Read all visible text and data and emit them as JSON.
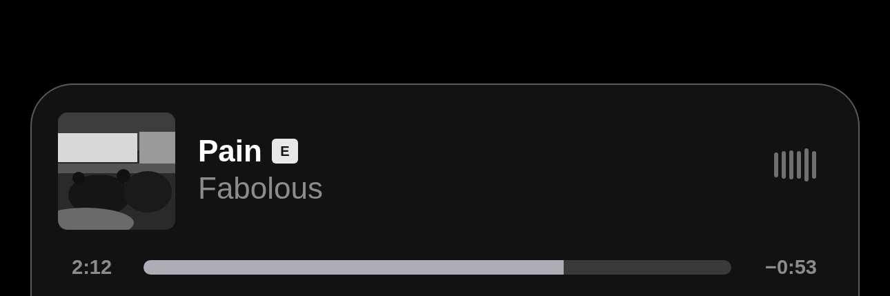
{
  "now_playing": {
    "title": "Pain",
    "explicit_badge": "E",
    "artist": "Fabolous",
    "playing": true
  },
  "progress": {
    "elapsed": "2:12",
    "remaining": "−0:53",
    "level": 0.715
  }
}
